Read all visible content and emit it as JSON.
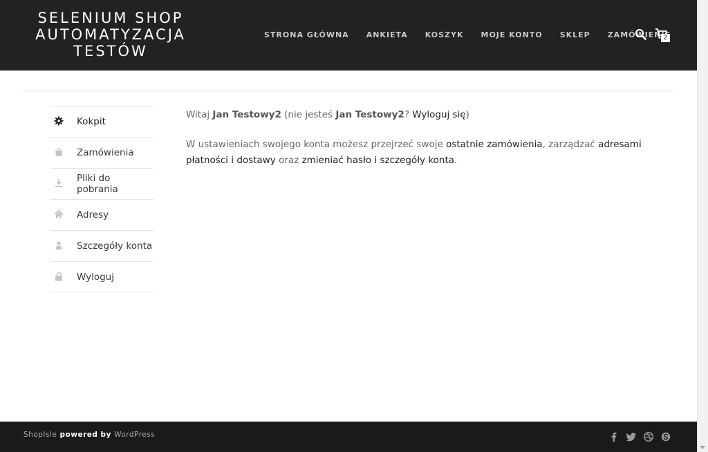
{
  "header": {
    "logo_line1": "SELENIUM SHOP",
    "logo_line2": "AUTOMATYZACJA",
    "logo_line3": "TESTÓW",
    "nav": [
      {
        "label": "STRONA GŁÓWNA"
      },
      {
        "label": "ANKIETA"
      },
      {
        "label": "KOSZYK"
      },
      {
        "label": "MOJE KONTO"
      },
      {
        "label": "SKLEP"
      },
      {
        "label": "ZAMÓWIENIE"
      }
    ],
    "cart_count": "2"
  },
  "sidebar": {
    "items": [
      {
        "label": "Kokpit",
        "icon": "gear-icon"
      },
      {
        "label": "Zamówienia",
        "icon": "bag-icon"
      },
      {
        "label": "Pliki do pobrania",
        "icon": "download-icon"
      },
      {
        "label": "Adresy",
        "icon": "home-icon"
      },
      {
        "label": "Szczegóły konta",
        "icon": "user-icon"
      },
      {
        "label": "Wyloguj",
        "icon": "lock-icon"
      }
    ],
    "active_index": 0
  },
  "content": {
    "greeting_prefix": "Witaj ",
    "user_name": "Jan Testowy2",
    "greeting_mid": " (nie jesteś ",
    "user_name_2": "Jan Testowy2",
    "greeting_q": "? ",
    "logout_link": "Wyloguj się",
    "greeting_end": ")",
    "desc_part1": "W ustawieniach swojego konta możesz przejrzeć swoje ",
    "link_orders": "ostatnie zamówienia",
    "desc_part2": ", zarządzać ",
    "link_addresses": "adresami płatności i dostawy",
    "desc_part3": " oraz ",
    "link_account": "zmieniać hasło i szczegóły konta",
    "desc_part4": "."
  },
  "footer": {
    "brand": "ShopIsle",
    "powered": " powered by ",
    "platform": "WordPress",
    "socials": [
      "facebook-icon",
      "twitter-icon",
      "dribbble-icon",
      "skype-icon"
    ]
  },
  "colors": {
    "header_bg": "#222222",
    "footer_bg": "#1a1a1a",
    "nav_text": "#c8c8c8",
    "body_text": "#666666",
    "link_text": "#222222"
  }
}
